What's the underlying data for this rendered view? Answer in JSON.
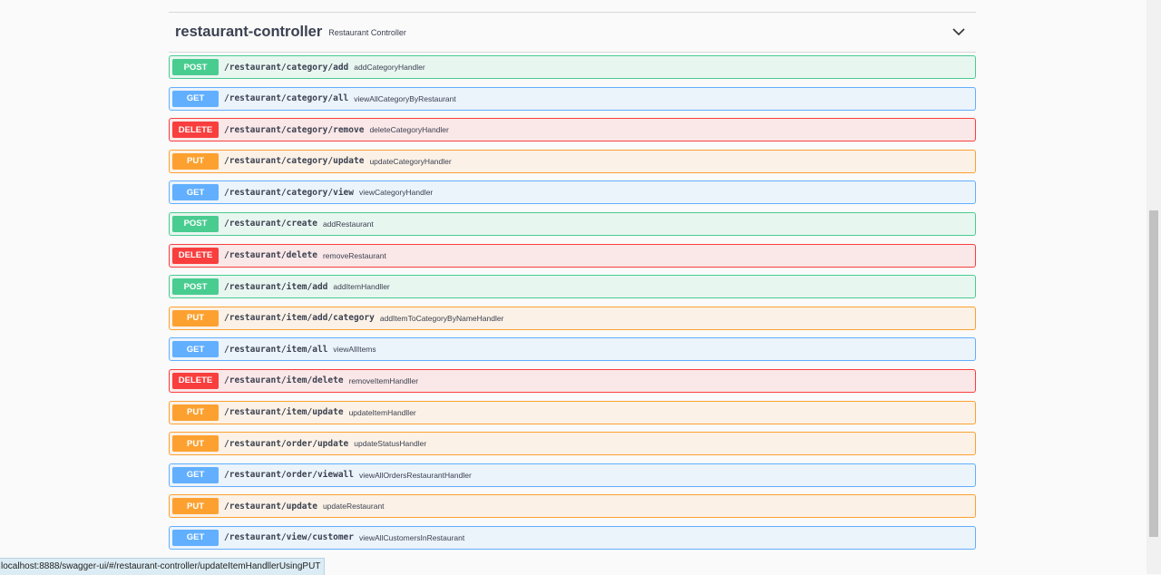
{
  "tag": {
    "title": "restaurant-controller",
    "description": "Restaurant Controller",
    "collapse_icon": "chevron-down-icon"
  },
  "operations": [
    {
      "method": "POST",
      "path": "/restaurant/category/add",
      "summary": "addCategoryHandler"
    },
    {
      "method": "GET",
      "path": "/restaurant/category/all",
      "summary": "viewAllCategoryByRestaurant"
    },
    {
      "method": "DELETE",
      "path": "/restaurant/category/remove",
      "summary": "deleteCategoryHandler"
    },
    {
      "method": "PUT",
      "path": "/restaurant/category/update",
      "summary": "updateCategoryHandler"
    },
    {
      "method": "GET",
      "path": "/restaurant/category/view",
      "summary": "viewCategoryHandler"
    },
    {
      "method": "POST",
      "path": "/restaurant/create",
      "summary": "addRestaurant"
    },
    {
      "method": "DELETE",
      "path": "/restaurant/delete",
      "summary": "removeRestaurant"
    },
    {
      "method": "POST",
      "path": "/restaurant/item/add",
      "summary": "addItemHandller"
    },
    {
      "method": "PUT",
      "path": "/restaurant/item/add/category",
      "summary": "addItemToCategoryByNameHandler"
    },
    {
      "method": "GET",
      "path": "/restaurant/item/all",
      "summary": "viewAllItems"
    },
    {
      "method": "DELETE",
      "path": "/restaurant/item/delete",
      "summary": "removeItemHandller"
    },
    {
      "method": "PUT",
      "path": "/restaurant/item/update",
      "summary": "updateItemHandller"
    },
    {
      "method": "PUT",
      "path": "/restaurant/order/update",
      "summary": "updateStatusHandler"
    },
    {
      "method": "GET",
      "path": "/restaurant/order/viewall",
      "summary": "viewAllOrdersRestaurantHandler"
    },
    {
      "method": "PUT",
      "path": "/restaurant/update",
      "summary": "updateRestaurant"
    },
    {
      "method": "GET",
      "path": "/restaurant/view/customer",
      "summary": "viewAllCustomersInRestaurant"
    }
  ],
  "colors": {
    "post": "#49cc90",
    "get": "#61affe",
    "put": "#fca130",
    "delete": "#f93e3e"
  },
  "status_bar": {
    "url": "localhost:8888/swagger-ui/#/restaurant-controller/updateItemHandllerUsingPUT"
  }
}
